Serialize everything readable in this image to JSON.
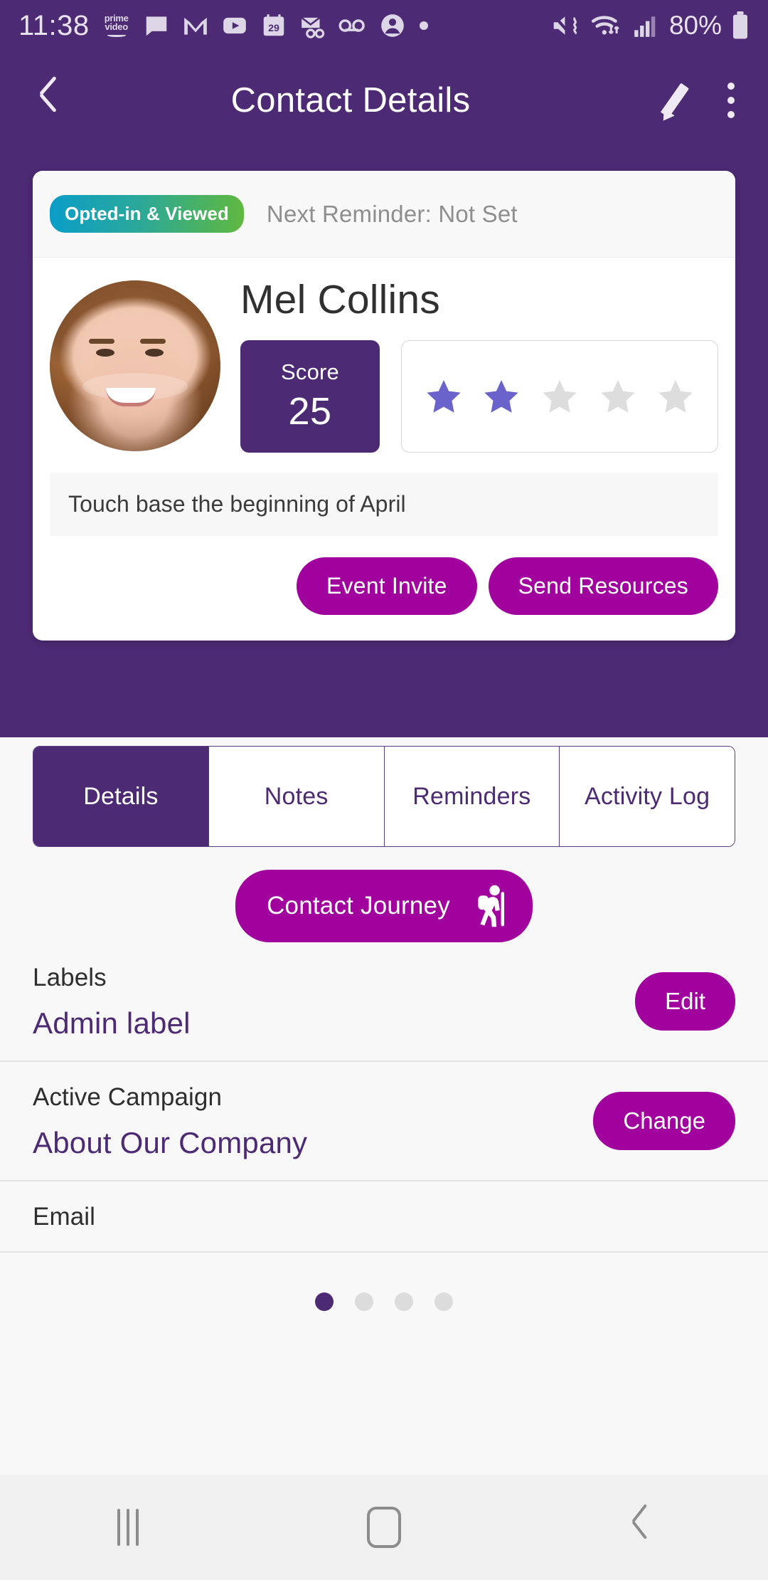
{
  "status_bar": {
    "time": "11:38",
    "battery_percent": "80%",
    "icons": [
      "prime-video-icon",
      "messages-icon",
      "gmail-icon",
      "youtube-icon",
      "calendar-29-icon",
      "email-voicemail-icon",
      "voicemail-icon",
      "account-icon",
      "dot-icon",
      "mute-vibrate-icon",
      "wifi-icon",
      "signal-icon",
      "battery-icon"
    ],
    "calendar_day": "29"
  },
  "app_bar": {
    "title": "Contact Details",
    "back_icon": "back-chevron-icon",
    "edit_icon": "pencil-icon",
    "overflow_icon": "kebab-menu-icon"
  },
  "contact_card": {
    "status_badge": "Opted-in & Viewed",
    "reminder": "Next Reminder: Not Set",
    "name": "Mel Collins",
    "score_label": "Score",
    "score_value": "25",
    "rating_filled": 2,
    "rating_total": 5,
    "note": "Touch base the beginning of April",
    "actions": [
      {
        "label": "Event Invite"
      },
      {
        "label": "Send Resources"
      }
    ]
  },
  "tabs": [
    {
      "label": "Details",
      "active": true
    },
    {
      "label": "Notes",
      "active": false
    },
    {
      "label": "Reminders",
      "active": false
    },
    {
      "label": "Activity Log",
      "active": false
    }
  ],
  "journey_button": {
    "label": "Contact Journey",
    "icon": "hiker-icon"
  },
  "detail_rows": [
    {
      "label": "Labels",
      "value": "Admin label",
      "button": "Edit"
    },
    {
      "label": "Active Campaign",
      "value": "About Our Company",
      "button": "Change"
    },
    {
      "label": "Email",
      "value": "",
      "button": ""
    }
  ],
  "pagination": {
    "total": 4,
    "active_index": 0
  },
  "nav_bar": {
    "recents_icon": "recents-icon",
    "home_icon": "home-icon",
    "back_icon": "nav-back-icon"
  },
  "colors": {
    "header_purple": "#4d2a74",
    "accent_magenta": "#a1029e",
    "star_filled": "#6b63cc",
    "star_empty": "#dddddd",
    "badge_from": "#0a9dc8",
    "badge_to": "#5fb83f"
  }
}
